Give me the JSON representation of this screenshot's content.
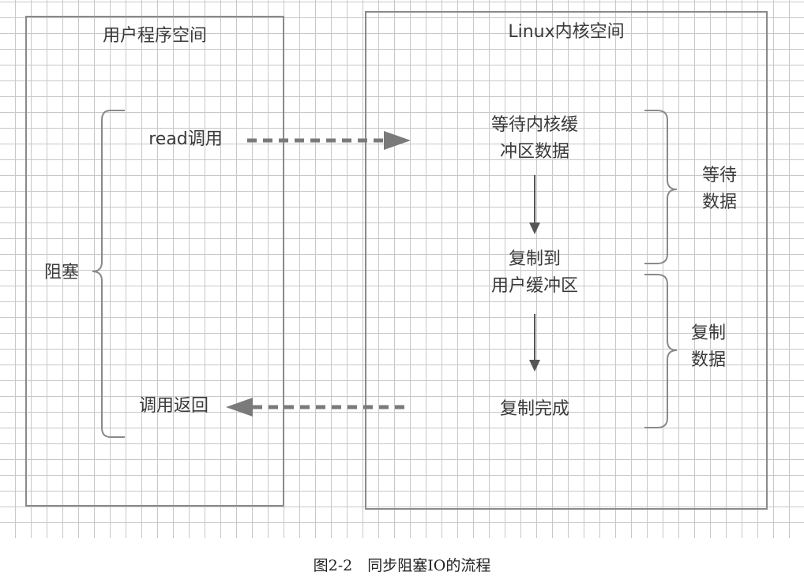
{
  "diagram": {
    "user_space": {
      "title": "用户程序空间"
    },
    "kernel_space": {
      "title": "Linux内核空间"
    },
    "user_nodes": {
      "read_call": "read调用",
      "call_return": "调用返回",
      "blocking": "阻塞"
    },
    "kernel_nodes": {
      "wait_data": "等待内核缓\n冲区数据",
      "copy_to_user": "复制到\n用户缓冲区",
      "copy_done": "复制完成"
    },
    "phases": {
      "wait_phase": "等待\n数据",
      "copy_phase": "复制\n数据"
    },
    "edges": [
      {
        "from": "read_call",
        "to": "wait_data",
        "style": "dashed"
      },
      {
        "from": "wait_data",
        "to": "copy_to_user",
        "style": "solid"
      },
      {
        "from": "copy_to_user",
        "to": "copy_done",
        "style": "solid"
      },
      {
        "from": "copy_done",
        "to": "call_return",
        "style": "dashed"
      }
    ],
    "colors": {
      "border": "#8a8a8a",
      "arrow": "#666666",
      "grid": "#c8c8c8"
    }
  },
  "caption": "图2-2　同步阻塞IO的流程"
}
